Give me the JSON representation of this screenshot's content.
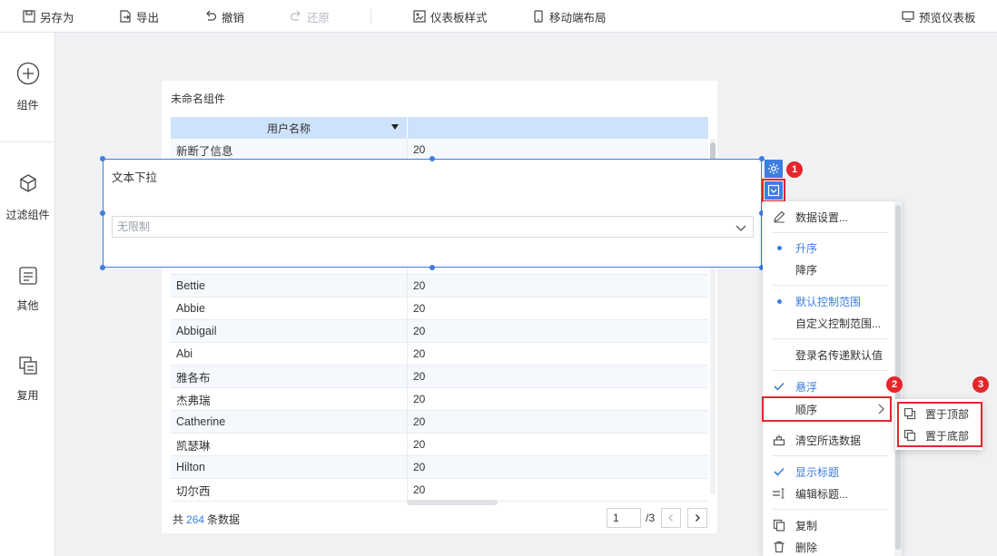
{
  "toolbar": {
    "save_as": "另存为",
    "export": "导出",
    "undo": "撤销",
    "redo": "还原",
    "dashboard_style": "仪表板样式",
    "mobile_layout": "移动端布局",
    "preview": "预览仪表板"
  },
  "sidebar": {
    "items": [
      {
        "label": "组件",
        "icon": "plus-circle-icon"
      },
      {
        "label": "过滤组件",
        "icon": "cube-icon"
      },
      {
        "label": "其他",
        "icon": "document-icon"
      },
      {
        "label": "复用",
        "icon": "copy-icon"
      }
    ]
  },
  "component": {
    "title": "未命名组件",
    "column_header": "用户名称",
    "rows": [
      {
        "name": "新断了信息",
        "value": "20"
      },
      {
        "name": "Bettie",
        "value": "20"
      },
      {
        "name": "Abbie",
        "value": "20"
      },
      {
        "name": "Abbigail",
        "value": "20"
      },
      {
        "name": "Abi",
        "value": "20"
      },
      {
        "name": "雅各布",
        "value": "20"
      },
      {
        "name": "杰弗瑞",
        "value": "20"
      },
      {
        "name": "Catherine",
        "value": "20"
      },
      {
        "name": "凯瑟琳",
        "value": "20"
      },
      {
        "name": "Hilton",
        "value": "20"
      },
      {
        "name": "切尔西",
        "value": "20"
      }
    ],
    "footer": {
      "prefix": "共",
      "count": "264",
      "suffix": "条数据",
      "page": "1",
      "total_pages": "/3"
    }
  },
  "widget": {
    "title": "文本下拉",
    "select_value": "无限制"
  },
  "badges": [
    "1",
    "2",
    "3"
  ],
  "menu": {
    "data_settings": "数据设置...",
    "ascending": "升序",
    "descending": "降序",
    "default_range": "默认控制范围",
    "custom_range": "自定义控制范围...",
    "login_default": "登录名传递默认值",
    "floating": "悬浮",
    "order": "顺序",
    "clear_selection": "清空所选数据",
    "show_title": "显示标题",
    "edit_title": "编辑标题...",
    "copy": "复制",
    "delete": "删除"
  },
  "submenu": {
    "bring_to_top": "置于顶部",
    "send_to_bottom": "置于底部"
  },
  "colors": {
    "accent": "#3d7ee0",
    "highlight_red": "#e5262b",
    "header_blue": "#cfe2fb"
  }
}
